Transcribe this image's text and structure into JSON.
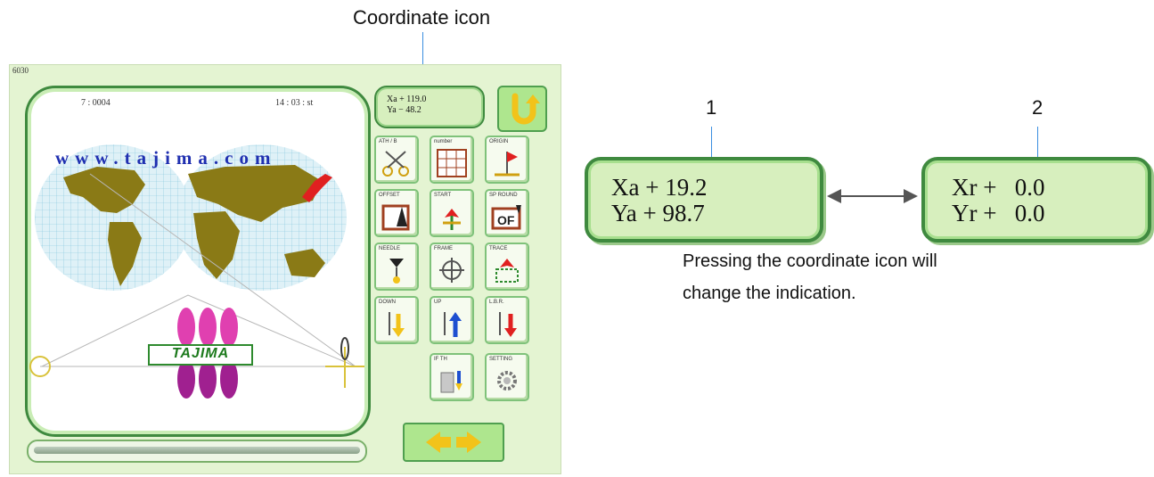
{
  "annotations": {
    "top_caption": "Coordinate icon",
    "marker_1": "1",
    "marker_2": "2",
    "explanation_line1": "Pressing the coordinate icon will",
    "explanation_line2": "change the indication."
  },
  "screen": {
    "id": "6030",
    "status_left": "7 : 0004",
    "status_right": "14 : 03 : st",
    "website": "www.tajima.com",
    "brand": "TAJIMA",
    "coord_small": {
      "line1": "Xa + 119.0",
      "line2": "Ya − 48.2"
    },
    "buttons": [
      {
        "label": "ATH / B"
      },
      {
        "label": "number"
      },
      {
        "label": "ORIGIN"
      },
      {
        "label": "OFFSET"
      },
      {
        "label": "START"
      },
      {
        "label": "SP ROUND"
      },
      {
        "label": "NEEDLE"
      },
      {
        "label": "FRAME"
      },
      {
        "label": "TRACE"
      },
      {
        "label": "DOWN"
      },
      {
        "label": "UP"
      },
      {
        "label": "L.B.R."
      },
      {
        "label": "IF TH"
      },
      {
        "label": "SETTING"
      }
    ]
  },
  "panel_absolute": {
    "line1": "Xa + 19.2",
    "line2": "Ya + 98.7"
  },
  "panel_relative": {
    "line1": "Xr +   0.0",
    "line2": "Yr +   0.0"
  },
  "colors": {
    "screen_bg": "#e4f4d2",
    "frame_green": "#3f8a3f",
    "panel_fill": "#d7efbe",
    "leader_blue": "#3a8ee0",
    "url_blue": "#1f2fb0",
    "continent": "#8a7a16",
    "japan_red": "#e02020",
    "logo_purple": "#a02090",
    "logo_pink": "#e040b0"
  },
  "icons": [
    "return-arrow-icon",
    "double-headed-arrow-icon",
    "left-arrow-icon",
    "right-arrow-icon"
  ]
}
